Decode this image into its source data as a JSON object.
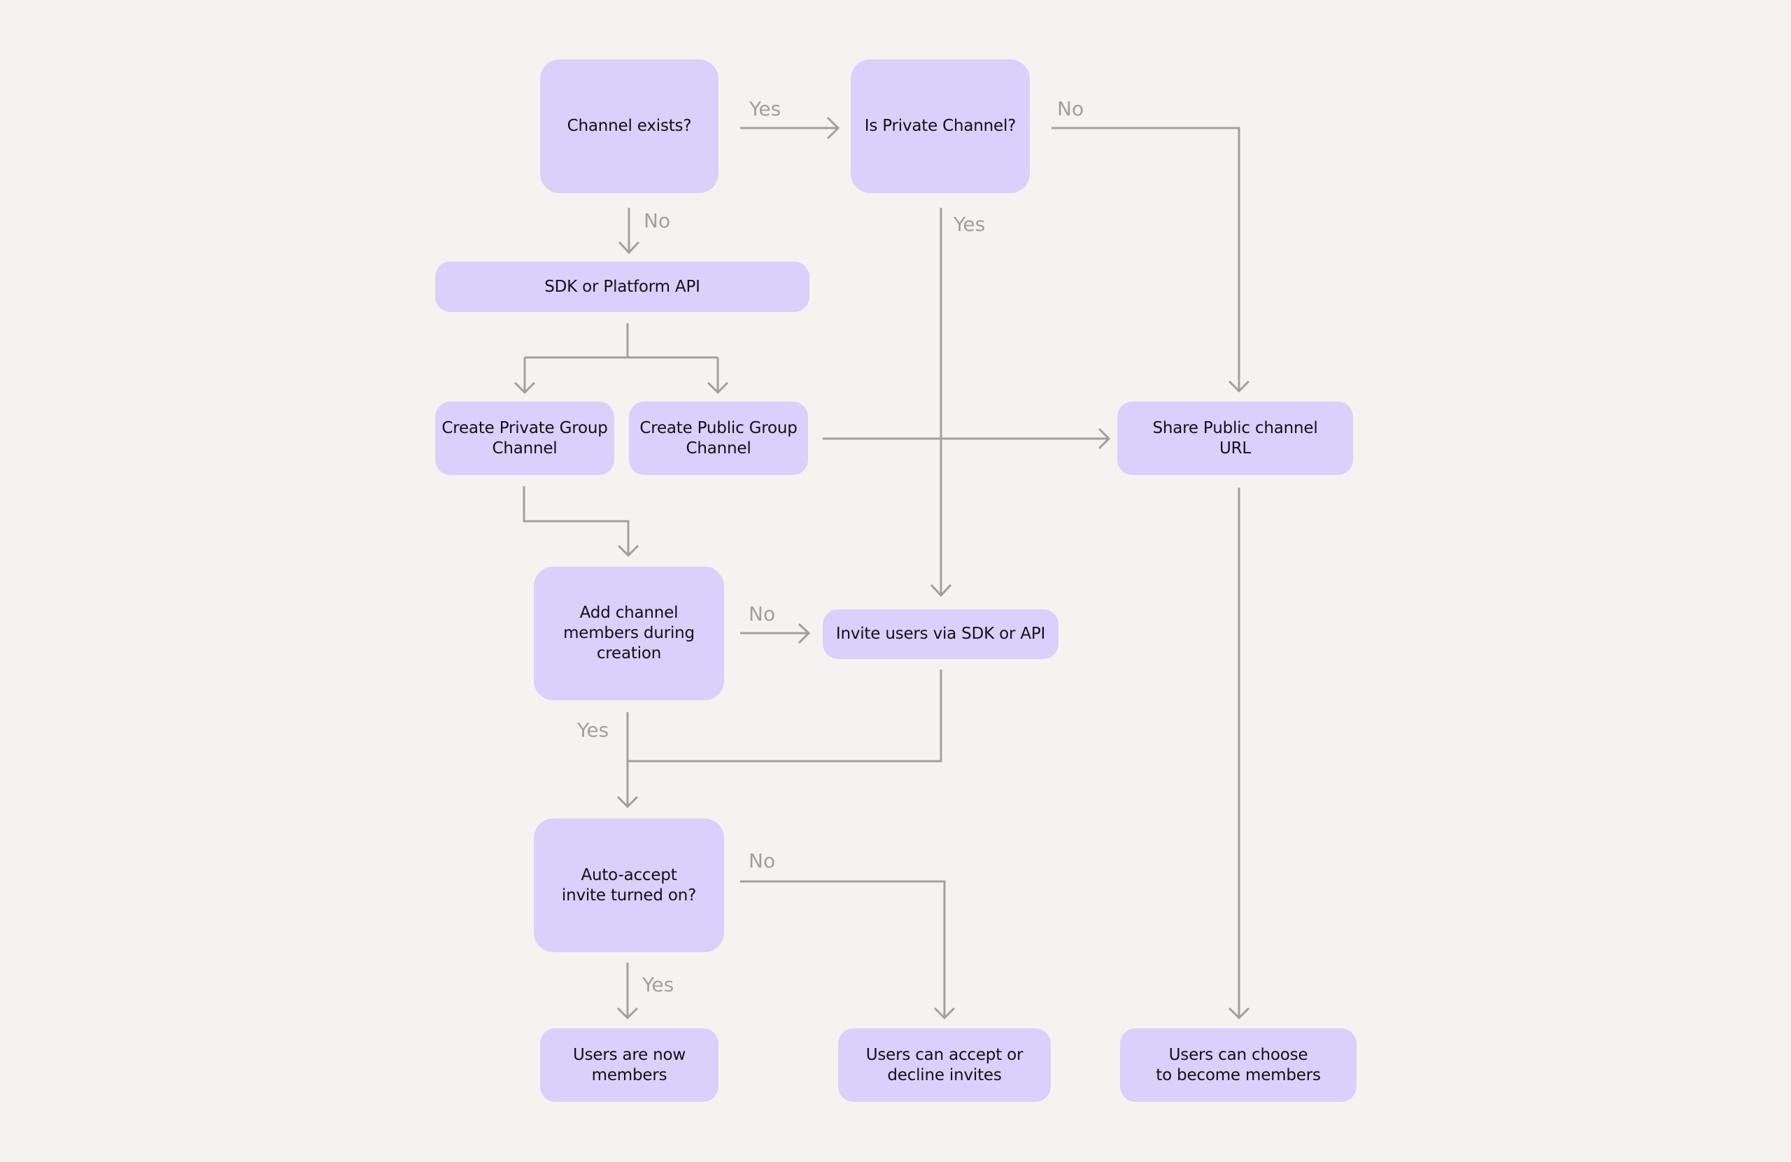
{
  "diagram": {
    "type": "flowchart",
    "colors": {
      "background": "#f4f3ef",
      "node_fill": "#d9d0fc",
      "node_text": "#111111",
      "connector": "#a0a0a0",
      "edge_label": "#a0a0a0"
    },
    "nodes": {
      "channel_exists": "Channel exists?",
      "is_private": "Is Private Channel?",
      "sdk_platform": "SDK or Platform API",
      "create_private": "Create Private Group\nChannel",
      "create_public": "Create Public Group\nChannel",
      "share_url": "Share Public channel\nURL",
      "add_members": "Add channel\nmembers during\ncreation",
      "invite_users": "Invite users via SDK or API",
      "auto_accept": "Auto-accept\ninvite turned on?",
      "users_members": "Users are now\nmembers",
      "users_accept_decline": "Users can accept or\ndecline invites",
      "users_choose": "Users can choose\nto become members"
    },
    "edge_labels": {
      "exists_yes": "Yes",
      "exists_no": "No",
      "private_no": "No",
      "private_yes": "Yes",
      "add_no": "No",
      "add_yes": "Yes",
      "auto_no": "No",
      "auto_yes": "Yes"
    },
    "edges": [
      {
        "from": "channel_exists",
        "to": "is_private",
        "label": "Yes"
      },
      {
        "from": "channel_exists",
        "to": "sdk_platform",
        "label": "No"
      },
      {
        "from": "is_private",
        "to": "share_url",
        "label": "No"
      },
      {
        "from": "is_private",
        "to": "invite_users",
        "label": "Yes"
      },
      {
        "from": "sdk_platform",
        "to": "create_private",
        "label": ""
      },
      {
        "from": "sdk_platform",
        "to": "create_public",
        "label": ""
      },
      {
        "from": "create_public",
        "to": "share_url",
        "label": ""
      },
      {
        "from": "create_private",
        "to": "add_members",
        "label": ""
      },
      {
        "from": "add_members",
        "to": "invite_users",
        "label": "No"
      },
      {
        "from": "add_members",
        "to": "auto_accept",
        "label": "Yes"
      },
      {
        "from": "invite_users",
        "to": "auto_accept",
        "label": ""
      },
      {
        "from": "auto_accept",
        "to": "users_members",
        "label": "Yes"
      },
      {
        "from": "auto_accept",
        "to": "users_accept_decline",
        "label": "No"
      },
      {
        "from": "share_url",
        "to": "users_choose",
        "label": ""
      }
    ]
  }
}
